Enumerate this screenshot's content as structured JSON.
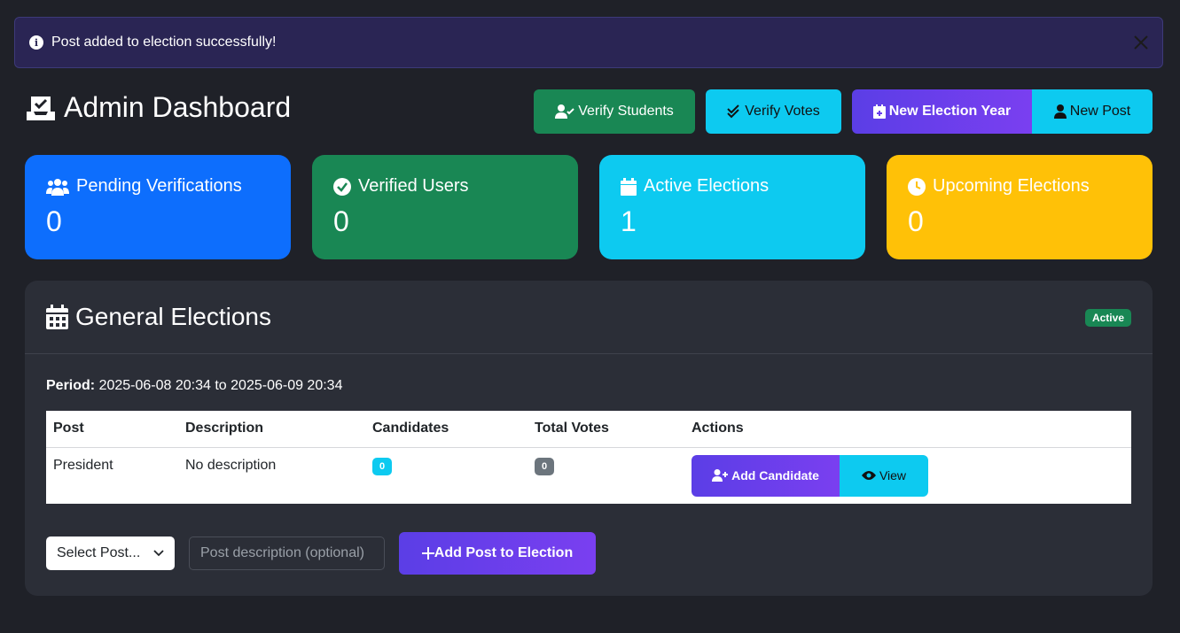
{
  "alert": {
    "message": "Post added to election successfully!",
    "icon": "info-icon"
  },
  "header": {
    "title": "Admin Dashboard",
    "buttons": {
      "verify_students": "Verify Students",
      "verify_votes": "Verify Votes",
      "new_election_year": "New Election Year",
      "new_post": "New Post"
    }
  },
  "stats": [
    {
      "label": "Pending Verifications",
      "value": "0",
      "icon": "users-icon"
    },
    {
      "label": "Verified Users",
      "value": "0",
      "icon": "check-circle-icon"
    },
    {
      "label": "Active Elections",
      "value": "1",
      "icon": "calendar-icon"
    },
    {
      "label": "Upcoming Elections",
      "value": "0",
      "icon": "clock-icon"
    }
  ],
  "election": {
    "title": "General Elections",
    "status": "Active",
    "period_label": "Period:",
    "period_value": "2025-06-08 20:34 to 2025-06-09 20:34",
    "table": {
      "headers": [
        "Post",
        "Description",
        "Candidates",
        "Total Votes",
        "Actions"
      ],
      "rows": [
        {
          "post": "President",
          "description": "No description",
          "candidates": "0",
          "total_votes": "0",
          "add_candidate": "Add Candidate",
          "view": "View"
        }
      ]
    },
    "form": {
      "select_value": "Select Post...",
      "description_placeholder": "Post description (optional)",
      "submit_label": "Add Post to Election"
    }
  },
  "colors": {
    "background": "#1f2128",
    "primary": "#0d6efd",
    "success": "#198754",
    "info": "#0dcaf0",
    "warning": "#ffc107",
    "purple": "#6f42f0"
  }
}
